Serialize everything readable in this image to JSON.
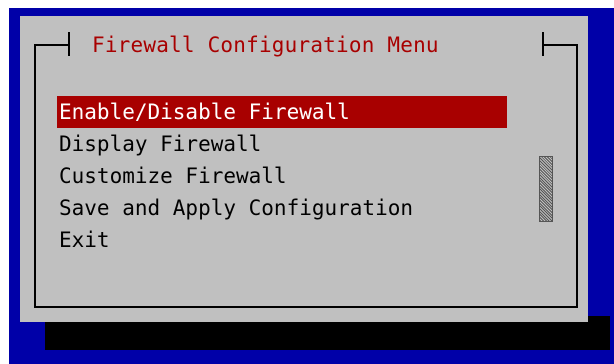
{
  "dialog": {
    "title": "Firewall Configuration Menu"
  },
  "menu": {
    "selected_index": 0,
    "items": [
      {
        "label": "Enable/Disable Firewall"
      },
      {
        "label": "Display Firewall"
      },
      {
        "label": "Customize Firewall"
      },
      {
        "label": "Save and Apply Configuration"
      },
      {
        "label": "Exit"
      }
    ]
  },
  "colors": {
    "background": "#0000a8",
    "dialog": "#c0c0c0",
    "title": "#a80000",
    "selection": "#a80000",
    "text": "#000000",
    "selected_text": "#ffffff"
  }
}
